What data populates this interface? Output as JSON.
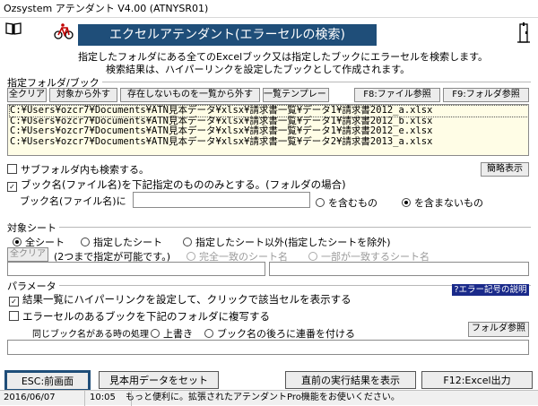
{
  "window": {
    "title": "Ozsystem アテンダント V4.00 (ATNYSR01)"
  },
  "banner": {
    "title": "エクセルアテンダント(エラーセルの検索)"
  },
  "description": {
    "line1": "指定したフォルダにある全てのExcelブック又は指定したブックにエラーセルを検索します。",
    "line2": "検索結果は、ハイパーリンクを設定したブックとして作成されます。"
  },
  "folder_group": {
    "label": "指定フォルダ/ブック",
    "buttons": {
      "clear_all": "全クリア",
      "exclude": "対象から外す",
      "list_missing": "存在しないものを一覧から外す",
      "list_template": "一覧テンプレート",
      "f8": "F8:ファイル参照",
      "f9": "F9:フォルダ参照"
    },
    "files": [
      "C:¥Users¥ozcr7¥Documents¥ATN見本データ¥xlsx¥請求書一覧¥データ1¥請求書2012_a.xlsx",
      "C:¥Users¥ozcr7¥Documents¥ATN見本データ¥xlsx¥請求書一覧¥データ1¥請求書2012_b.xlsx",
      "C:¥Users¥ozcr7¥Documents¥ATN見本データ¥xlsx¥請求書一覧¥データ1¥請求書2012_e.xlsx",
      "C:¥Users¥ozcr7¥Documents¥ATN見本データ¥xlsx¥請求書一覧¥データ2¥請求書2013_a.xlsx"
    ]
  },
  "options": {
    "subfolder_label": "サブフォルダ内も検索する。",
    "simple_view": "簡略表示",
    "book_filter_label": "ブック名(ファイル名)を下記指定のもののみとする。(フォルダの場合)",
    "book_name_label": "ブック名(ファイル名)に",
    "book_name_value": "",
    "contains": "を含むもの",
    "not_contains": "を含まないもの"
  },
  "sheet_group": {
    "label": "対象シート",
    "all": "全シート",
    "specified": "指定したシート",
    "except": "指定したシート以外(指定したシートを除外)",
    "clear_all": "全クリア",
    "note": "(2つまで指定が可能です。)",
    "exact": "完全一致のシート名",
    "partial": "一部が一致するシート名",
    "sheet1": "",
    "sheet2": ""
  },
  "param_group": {
    "label": "パラメータ",
    "error_help": "?エラー記号の説明",
    "hyperlink": "結果一覧にハイパーリンクを設定して、クリックで該当セルを表示する",
    "copy_books": "エラーセルのあるブックを下記のフォルダに複写する",
    "same_name": "同じブック名がある時の処理",
    "overwrite": "上書き",
    "serial": "ブック名の後ろに連番を付ける",
    "folder_ref": "フォルダ参照",
    "copy_path": ""
  },
  "footer": {
    "esc": "ESC:前画面",
    "sample": "見本用データをセット",
    "show_last": "直前の実行結果を表示",
    "f12": "F12:Excel出力"
  },
  "status": {
    "date": "2016/06/07",
    "time": "10:05",
    "message": "もっと便利に。拡張されたアテンダントPro機能をお使いください。"
  }
}
